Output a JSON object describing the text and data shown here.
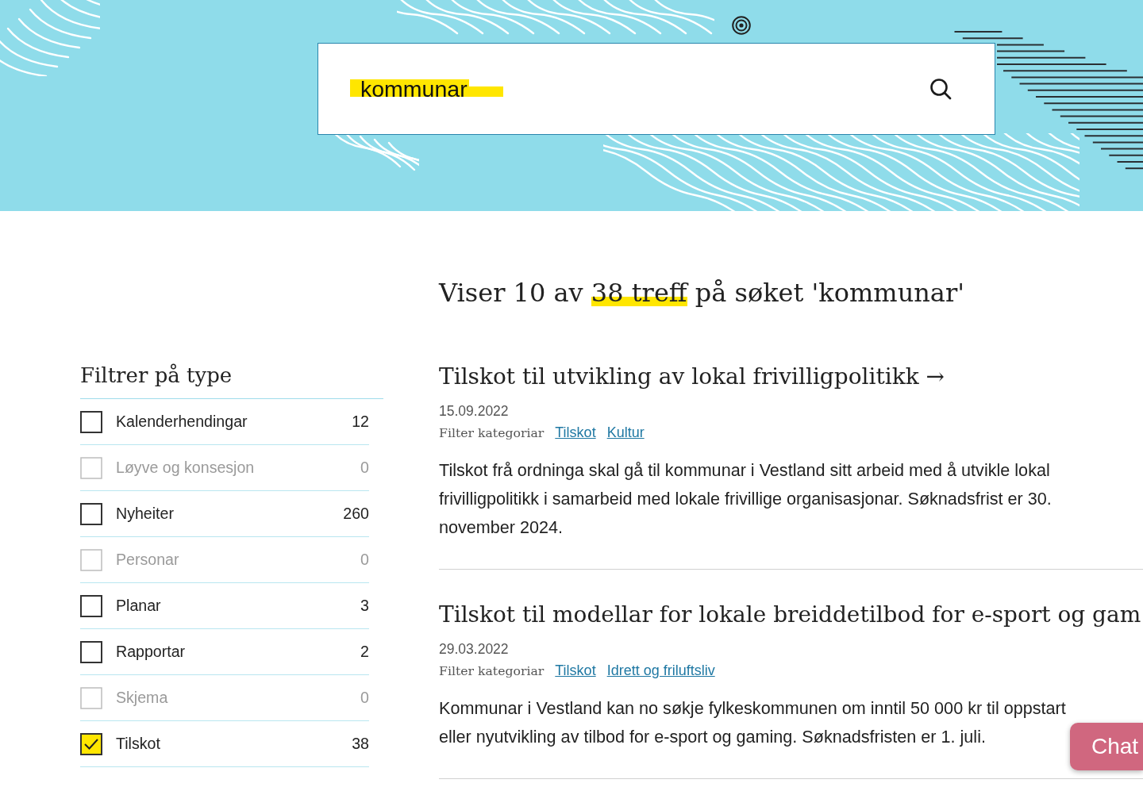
{
  "search": {
    "value": "kommunar",
    "highlighted": true
  },
  "summary": {
    "segments": [
      {
        "text": "Viser 10 av ",
        "highlighted": false
      },
      {
        "text": "38 treff",
        "highlighted": true
      },
      {
        "text": " på søket 'kommunar'",
        "highlighted": false
      }
    ]
  },
  "filters": {
    "title": "Filtrer på type",
    "items": [
      {
        "label": "Kalenderhendingar",
        "count": "12",
        "checked": false,
        "disabled": false,
        "highlighted": false
      },
      {
        "label": "Løyve og konsesjon",
        "count": "0",
        "checked": false,
        "disabled": true,
        "highlighted": false
      },
      {
        "label": "Nyheiter",
        "count": "260",
        "checked": false,
        "disabled": false,
        "highlighted": false
      },
      {
        "label": "Personar",
        "count": "0",
        "checked": false,
        "disabled": true,
        "highlighted": false
      },
      {
        "label": "Planar",
        "count": "3",
        "checked": false,
        "disabled": false,
        "highlighted": false
      },
      {
        "label": "Rapportar",
        "count": "2",
        "checked": false,
        "disabled": false,
        "highlighted": false
      },
      {
        "label": "Skjema",
        "count": "0",
        "checked": false,
        "disabled": true,
        "highlighted": false
      },
      {
        "label": "Tilskot",
        "count": "38",
        "checked": true,
        "disabled": false,
        "highlighted": true
      }
    ]
  },
  "results": [
    {
      "title": "Tilskot til utvikling av lokal frivilligpolitikk →",
      "date": "15.09.2022",
      "category_label": "Filter kategoriar",
      "categories": [
        "Tilskot",
        "Kultur"
      ],
      "excerpt": "Tilskot frå ordninga skal gå til kommunar i Vestland sitt arbeid med å utvikle lokal frivilligpolitikk i samarbeid med lokale frivillige organisasjonar. Søknadsfrist er 30. november 2024."
    },
    {
      "title": "Tilskot til modellar for lokale breiddetilbod for e-sport og gam",
      "date": "29.03.2022",
      "category_label": "Filter kategoriar",
      "categories": [
        "Tilskot",
        "Idrett og friluftsliv"
      ],
      "excerpt": "Kommunar i Vestland kan no søkje fylkeskommunen om inntil 50 000 kr til oppstart eller nyutvikling av tilbod for e-sport og gaming. Søknadsfristen er 1. juli."
    }
  ],
  "chat_button": {
    "label": "Chat"
  }
}
